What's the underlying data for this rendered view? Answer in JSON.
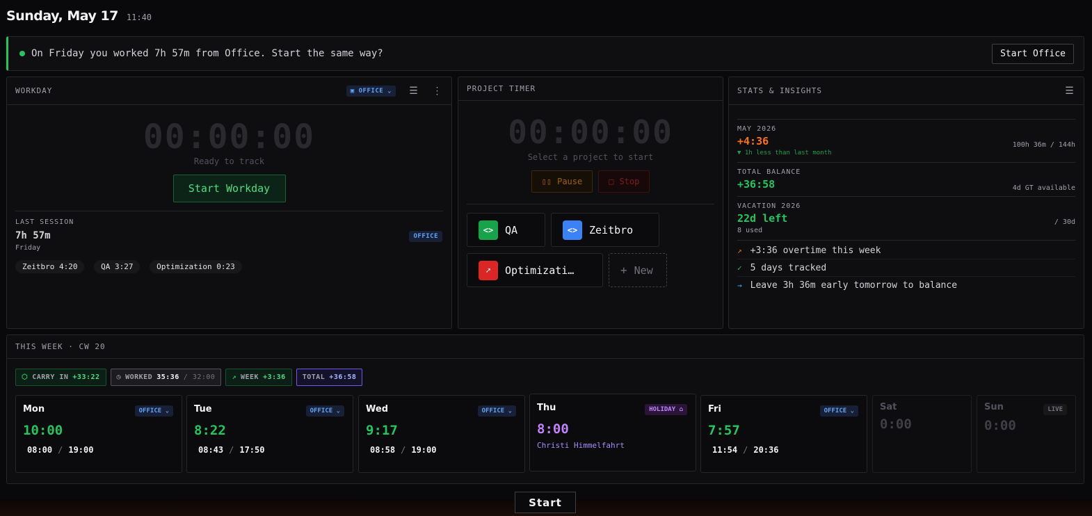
{
  "header": {
    "date": "Sunday, May 17",
    "time": "11:40"
  },
  "banner": {
    "message": "On Friday you worked 7h 57m from Office. Start the same way?",
    "button": "Start Office"
  },
  "workday": {
    "title": "WORKDAY",
    "mode": "OFFICE",
    "timer": "00:00:00",
    "status": "Ready to track",
    "start_button": "Start Workday",
    "last_session": {
      "label": "LAST SESSION",
      "duration": "7h 57m",
      "day": "Friday",
      "badge": "OFFICE",
      "chips": [
        "Zeitbro 4:20",
        "QA 3:27",
        "Optimization 0:23"
      ]
    }
  },
  "project_timer": {
    "title": "PROJECT TIMER",
    "timer": "00:00:00",
    "hint": "Select a project to start",
    "pause": "Pause",
    "stop": "Stop",
    "projects": [
      {
        "name": "QA",
        "color": "#16a34a"
      },
      {
        "name": "Zeitbro",
        "color": "#3b82f6"
      },
      {
        "name": "Optimizati…",
        "color": "#dc2626"
      }
    ],
    "new_label": "New"
  },
  "stats": {
    "title": "STATS & INSIGHTS",
    "month": {
      "label": "MAY 2026",
      "value": "+4:36",
      "right": "100h 36m / 144h",
      "delta": "▼ 1h less than last month"
    },
    "balance": {
      "label": "TOTAL BALANCE",
      "value": "+36:58",
      "right": "4d GT available"
    },
    "vacation": {
      "label": "VACATION 2026",
      "value": "22d left",
      "right": "/ 30d",
      "used": "8 used"
    },
    "insights": [
      {
        "icon": "↗",
        "text": "+3:36 overtime this week",
        "color": "#f97316"
      },
      {
        "icon": "✓",
        "text": "5 days tracked",
        "color": "#22c55e"
      },
      {
        "icon": "→",
        "text": "Leave 3h 36m early tomorrow to balance",
        "color": "#38bdf8"
      }
    ]
  },
  "week": {
    "title": "THIS WEEK · CW 20",
    "carry_label": "CARRY IN",
    "carry_value": "+33:22",
    "worked_label": "WORKED",
    "worked_value": "35:36",
    "worked_target": "/ 32:00",
    "week_label": "WEEK",
    "week_value": "+3:36",
    "total_label": "TOTAL",
    "total_value": "+36:58",
    "days": [
      {
        "name": "Mon",
        "badge": "OFFICE",
        "value": "10:00",
        "start": "08:00",
        "end": "19:00"
      },
      {
        "name": "Tue",
        "badge": "OFFICE",
        "value": "8:22",
        "start": "08:43",
        "end": "17:50"
      },
      {
        "name": "Wed",
        "badge": "OFFICE",
        "value": "9:17",
        "start": "08:58",
        "end": "19:00"
      },
      {
        "name": "Thu",
        "badge": "HOLIDAY",
        "value": "8:00",
        "note": "Christi Himmelfahrt"
      },
      {
        "name": "Fri",
        "badge": "OFFICE",
        "value": "7:57",
        "start": "11:54",
        "end": "20:36"
      },
      {
        "name": "Sat",
        "value": "0:00"
      },
      {
        "name": "Sun",
        "badge": "LIVE",
        "value": "0:00"
      }
    ],
    "range_sep": "/"
  },
  "footer": {
    "start": "Start"
  }
}
